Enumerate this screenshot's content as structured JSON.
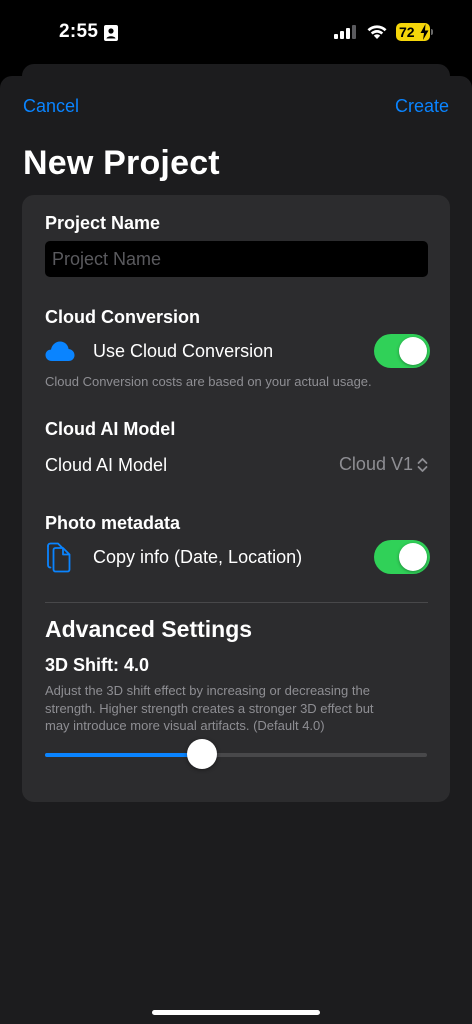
{
  "status_bar": {
    "time": "2:55",
    "battery": "72",
    "icons": [
      "person-badge-icon",
      "cellular-signal-icon",
      "wifi-icon",
      "battery-icon",
      "charging-bolt-icon"
    ]
  },
  "nav": {
    "cancel_label": "Cancel",
    "create_label": "Create"
  },
  "title": "New Project",
  "project_name": {
    "label": "Project Name",
    "placeholder": "Project Name",
    "value": ""
  },
  "cloud_conversion": {
    "label": "Cloud Conversion",
    "toggle_label": "Use Cloud Conversion",
    "enabled": true,
    "icon": "cloud-icon",
    "footnote": "Cloud Conversion costs are based on your actual usage."
  },
  "cloud_ai_model": {
    "label": "Cloud AI Model",
    "row_label": "Cloud AI Model",
    "selected": "Cloud V1",
    "icon": "chevron-up-down-icon"
  },
  "photo_metadata": {
    "label": "Photo metadata",
    "toggle_label": "Copy info (Date, Location)",
    "enabled": true,
    "icon": "document-copy-icon"
  },
  "advanced": {
    "title": "Advanced Settings",
    "shift_label": "3D Shift: 4.0",
    "description_line1": "Adjust the 3D shift effect by increasing or decreasing the",
    "description_line2": "strength. Higher strength creates a stronger 3D effect but",
    "description_line3": "may introduce more visual artifacts. (Default 4.0)",
    "slider_fraction": 0.41
  },
  "colors": {
    "accent": "#0a84ff",
    "toggle_on": "#30d158",
    "background": "#000000",
    "sheet": "#1c1c1e",
    "card": "#2c2c2e",
    "secondary_text": "#8e8e93",
    "battery": "#f5d60a"
  }
}
